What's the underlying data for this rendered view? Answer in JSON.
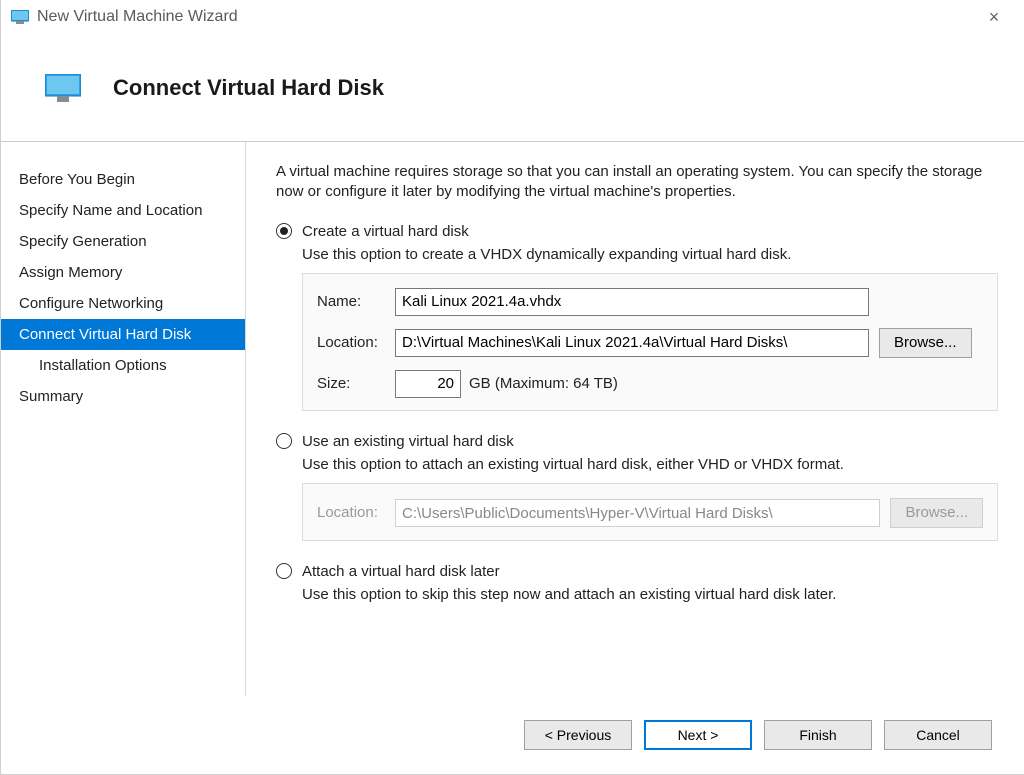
{
  "window": {
    "title": "New Virtual Machine Wizard"
  },
  "header": {
    "page_title": "Connect Virtual Hard Disk"
  },
  "sidebar": {
    "items": [
      {
        "label": "Before You Begin",
        "selected": false,
        "child": false
      },
      {
        "label": "Specify Name and Location",
        "selected": false,
        "child": false
      },
      {
        "label": "Specify Generation",
        "selected": false,
        "child": false
      },
      {
        "label": "Assign Memory",
        "selected": false,
        "child": false
      },
      {
        "label": "Configure Networking",
        "selected": false,
        "child": false
      },
      {
        "label": "Connect Virtual Hard Disk",
        "selected": true,
        "child": false
      },
      {
        "label": "Installation Options",
        "selected": false,
        "child": true
      },
      {
        "label": "Summary",
        "selected": false,
        "child": false
      }
    ]
  },
  "content": {
    "intro": "A virtual machine requires storage so that you can install an operating system. You can specify the storage now or configure it later by modifying the virtual machine's properties.",
    "opt_create": {
      "label": "Create a virtual hard disk",
      "desc": "Use this option to create a VHDX dynamically expanding virtual hard disk.",
      "name_label": "Name:",
      "name_value": "Kali Linux 2021.4a.vhdx",
      "loc_label": "Location:",
      "loc_value": "D:\\Virtual Machines\\Kali Linux 2021.4a\\Virtual Hard Disks\\",
      "browse_label": "Browse...",
      "size_label": "Size:",
      "size_value": "20",
      "size_note": "GB (Maximum: 64 TB)"
    },
    "opt_existing": {
      "label": "Use an existing virtual hard disk",
      "desc": "Use this option to attach an existing virtual hard disk, either VHD or VHDX format.",
      "loc_label": "Location:",
      "loc_value": "C:\\Users\\Public\\Documents\\Hyper-V\\Virtual Hard Disks\\",
      "browse_label": "Browse..."
    },
    "opt_later": {
      "label": "Attach a virtual hard disk later",
      "desc": "Use this option to skip this step now and attach an existing virtual hard disk later."
    }
  },
  "footer": {
    "previous": "< Previous",
    "next": "Next >",
    "finish": "Finish",
    "cancel": "Cancel"
  }
}
